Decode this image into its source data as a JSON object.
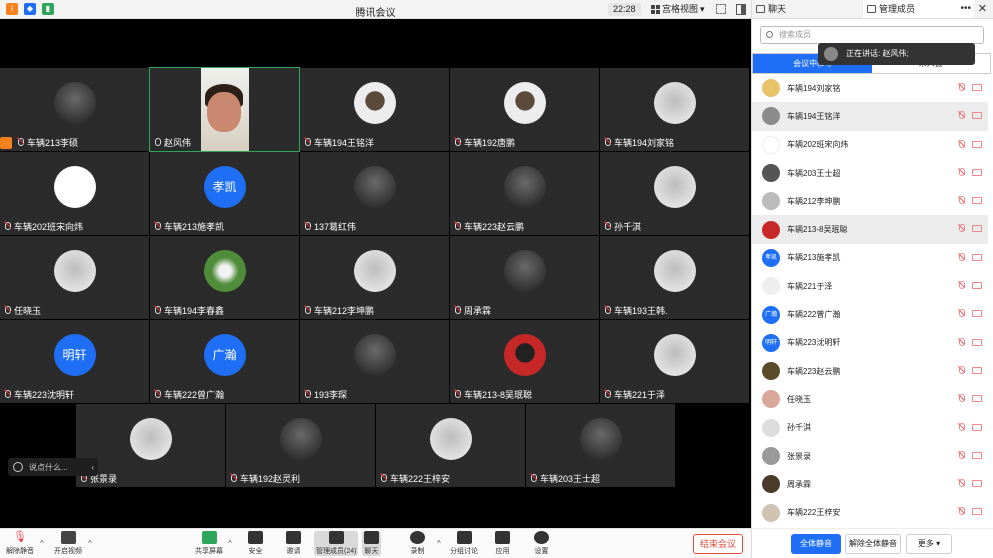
{
  "window": {
    "title": "腾讯会议",
    "time": "22:28",
    "view_mode": "宫格视图"
  },
  "colors": {
    "accent": "#1e6ff5",
    "end": "#e74c3c",
    "tile": "#2b2b2b",
    "active_border": "#2ea65a"
  },
  "tiles": [
    {
      "name": "车辆213李硕",
      "avatar": "photo-dark",
      "host": true
    },
    {
      "name": "赵风伟",
      "avatar": "video",
      "mic_on": true
    },
    {
      "name": "车辆194王铭洋",
      "avatar": "photo-cartoon"
    },
    {
      "name": "车辆192唐鹏",
      "avatar": "photo-cartoon"
    },
    {
      "name": "车辆194刘家铭",
      "avatar": "photo-light"
    },
    {
      "name": "车辆202班宋向炜",
      "avatar": "white"
    },
    {
      "name": "车辆213施孝凯",
      "avatar_text": "孝凯"
    },
    {
      "name": "137葛红伟",
      "avatar": "photo-dark"
    },
    {
      "name": "车辆223赵云鹏",
      "avatar": "photo-dark"
    },
    {
      "name": "孙千淇",
      "avatar": "photo-light"
    },
    {
      "name": "任晓玉",
      "avatar": "photo-light"
    },
    {
      "name": "车辆194李春鑫",
      "avatar": "photo-green"
    },
    {
      "name": "车辆212李坤鹏",
      "avatar": "photo-light"
    },
    {
      "name": "周承霖",
      "avatar": "photo-dark"
    },
    {
      "name": "车辆193王韩.",
      "avatar": "photo-light"
    },
    {
      "name": "车辆223沈明轩",
      "avatar_text": "明轩"
    },
    {
      "name": "车辆222曾广瀚",
      "avatar_text": "广瀚"
    },
    {
      "name": "193李琛",
      "avatar": "photo-dark"
    },
    {
      "name": "车辆213-8吴珉聪",
      "avatar": "photo-red"
    },
    {
      "name": "车辆221于泽",
      "avatar": "photo-light"
    },
    {
      "name": "张景录",
      "avatar": "photo-light"
    },
    {
      "name": "车辆192赵灵利",
      "avatar": "photo-dark"
    },
    {
      "name": "车辆222王梓安",
      "avatar": "photo-light"
    },
    {
      "name": "车辆203王士超",
      "avatar": "photo-dark"
    }
  ],
  "chat_input": {
    "placeholder": "说点什么..."
  },
  "toolbar": {
    "unmute": "解除静音",
    "start_video": "开启视频",
    "share": "共享屏幕",
    "security": "安全",
    "invite": "邀请",
    "members": "管理成员(24)",
    "chat": "聊天",
    "record": "录制",
    "breakout": "分组讨论",
    "apps": "应用",
    "settings": "设置",
    "end": "结束会议"
  },
  "panel": {
    "tab_chat": "聊天",
    "tab_members": "管理成员",
    "dots": "•••",
    "close": "✕",
    "search_placeholder": "搜索成员",
    "speaking": "正在讲话: 赵风伟;",
    "filter_in": "会议中(24)",
    "filter_out": "未入会",
    "members": [
      {
        "name": "车辆194刘家铭",
        "color": "#e9c36a"
      },
      {
        "name": "车辆194王铭洋",
        "color": "#8b8b8b",
        "highlight": true
      },
      {
        "name": "车辆202班宋向炜",
        "color": "#ffffff"
      },
      {
        "name": "车辆203王士超",
        "color": "#555555"
      },
      {
        "name": "车辆212李坤鹏",
        "color": "#bbbbbb"
      },
      {
        "name": "车辆213-8吴珉聪",
        "color": "#c62828",
        "highlight": true
      },
      {
        "name": "车辆213施孝凯",
        "avatar_text": "孝凯"
      },
      {
        "name": "车辆221于泽",
        "color": "#eeeeee"
      },
      {
        "name": "车辆222曾广瀚",
        "avatar_text": "广瀚"
      },
      {
        "name": "车辆223沈明轩",
        "avatar_text": "明轩"
      },
      {
        "name": "车辆223赵云鹏",
        "color": "#5a4a2a"
      },
      {
        "name": "任晓玉",
        "color": "#d9a89a"
      },
      {
        "name": "孙千淇",
        "color": "#dddddd"
      },
      {
        "name": "张景录",
        "color": "#999999"
      },
      {
        "name": "周承霖",
        "color": "#4a3a2a"
      },
      {
        "name": "车辆222王梓安",
        "color": "#cfc3b4"
      }
    ],
    "mute_all": "全体静音",
    "unmute_all": "解除全体静音",
    "more": "更多"
  }
}
